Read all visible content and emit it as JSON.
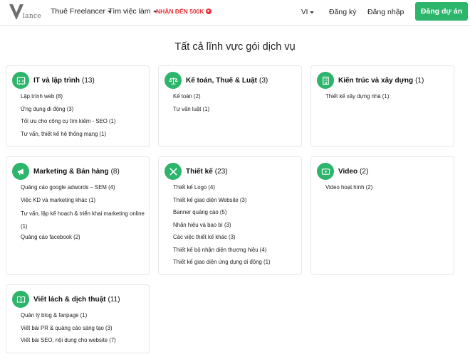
{
  "header": {
    "logo_text": "lance",
    "nav": [
      {
        "label": "Thuê Freelancer"
      },
      {
        "label": "Tìm việc làm"
      }
    ],
    "promo": {
      "label": "NHẬN ĐẾN 500K"
    },
    "language": "VI",
    "register": "Đăng ký",
    "login": "Đăng nhập",
    "post_project": "Đăng dự án"
  },
  "page_title": "Tất cả lĩnh vực gói dịch vụ",
  "colors": {
    "accent": "#2cb56b",
    "promo": "#e8333a"
  },
  "categories": [
    {
      "title": "IT và lập trình",
      "count": "(13)",
      "icon": "code-window-icon",
      "items": [
        "Lập trình web (8)",
        "Ứng dụng di động (3)",
        "Tối ưu cho công cụ tìm kiếm - SEO (1)",
        "Tư vấn, thiết kế hệ thống mạng (1)"
      ]
    },
    {
      "title": "Kế toán, Thuế & Luật",
      "count": "(3)",
      "icon": "scales-icon",
      "items": [
        "Kế toán (2)",
        "Tư vấn luật (1)"
      ]
    },
    {
      "title": "Kiến trúc và xây dựng",
      "count": "(1)",
      "icon": "building-icon",
      "items": [
        "Thiết kế xây dựng nhà (1)"
      ]
    },
    {
      "title": "Marketing & Bán hàng",
      "count": "(8)",
      "icon": "megaphone-icon",
      "items": [
        "Quảng cáo google adwords – SEM (4)",
        "Việc KD và marketing khác (1)",
        "Tư vấn, lập kế hoạch & triển khai marketing online (1)",
        "Quảng cáo facebook (2)"
      ]
    },
    {
      "title": "Thiết kế",
      "count": "(23)",
      "icon": "design-tools-icon",
      "items": [
        "Thiết kế Logo (4)",
        "Thiết kế giao diện Website (3)",
        "Banner quảng cáo (5)",
        "Nhãn hiệu và bao bì (3)",
        "Các việc thiết kế khác (3)",
        "Thiết kế bộ nhận diện thương hiệu (4)",
        "Thiết kế giao diện ứng dụng di động (1)"
      ]
    },
    {
      "title": "Video",
      "count": "(2)",
      "icon": "video-play-icon",
      "items": [
        "Video hoạt hình (2)"
      ]
    },
    {
      "title": "Viết lách & dịch thuật",
      "count": "(11)",
      "icon": "open-book-icon",
      "items": [
        "Quản lý blog & fanpage (1)",
        "Viết bài PR & quảng cáo sáng tạo (3)",
        "Viết bài SEO, nội dung cho website (7)"
      ]
    }
  ]
}
